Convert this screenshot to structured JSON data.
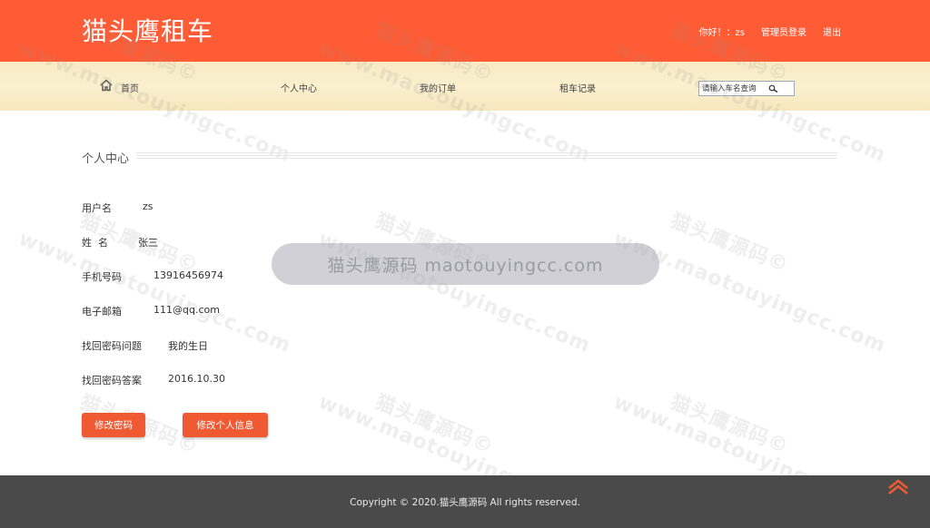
{
  "header": {
    "logo": "猫头鹰租车",
    "greeting": "你好！：zs",
    "admin_login": "管理员登录",
    "logout": "退出"
  },
  "nav": {
    "home": "首页",
    "profile": "个人中心",
    "orders": "我的订单",
    "rental_history": "租车记录",
    "search_placeholder": "请输入车名查询"
  },
  "profile": {
    "title": "个人中心",
    "fields": [
      {
        "label": "用户名",
        "value": "zs"
      },
      {
        "label": "姓  名",
        "value": "张三"
      },
      {
        "label": "手机号码",
        "value": "13916456974"
      },
      {
        "label": "电子邮箱",
        "value": "111@qq.com"
      },
      {
        "label": "找回密码问题",
        "value": "我的生日"
      },
      {
        "label": "找回密码答案",
        "value": "2016.10.30"
      }
    ],
    "change_password_button": "修改密码",
    "edit_info_button": "修改个人信息"
  },
  "overlay_text": "猫头鹰源码 maotouyingcc.com",
  "watermark": {
    "cn": "猫头鹰源码©",
    "en": "www.maotouyingcc.com"
  },
  "footer": {
    "copyright": "Copyright © 2020.猫头鹰源码 All rights reserved."
  },
  "colors": {
    "brand": "#ff5b34",
    "button": "#f05a33",
    "footer_bg": "#4a4a4a"
  }
}
